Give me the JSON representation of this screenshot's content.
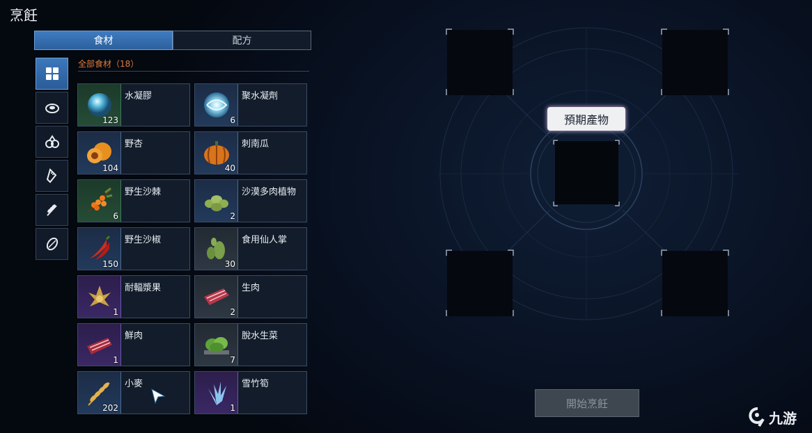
{
  "window": {
    "title": "烹飪"
  },
  "tabs": [
    {
      "label": "食材",
      "active": true
    },
    {
      "label": "配方",
      "active": false
    }
  ],
  "sidebar": {
    "items": [
      {
        "icon": "grid-icon",
        "active": true
      },
      {
        "icon": "meat-icon",
        "active": false
      },
      {
        "icon": "fruit-icon",
        "active": false
      },
      {
        "icon": "salt-shaker-icon",
        "active": false
      },
      {
        "icon": "wheat-icon",
        "active": false
      },
      {
        "icon": "seed-icon",
        "active": false
      }
    ]
  },
  "category": {
    "label": "全部食材（18）"
  },
  "ingredients": [
    {
      "name": "水凝膠",
      "count": "123",
      "rarity": "green",
      "icon": "water-orb-icon"
    },
    {
      "name": "聚水凝劑",
      "count": "6",
      "rarity": "blue",
      "icon": "water-swirl-icon"
    },
    {
      "name": "野杏",
      "count": "104",
      "rarity": "blue",
      "icon": "apricot-icon"
    },
    {
      "name": "刺南瓜",
      "count": "40",
      "rarity": "blue",
      "icon": "pumpkin-icon"
    },
    {
      "name": "野生沙棘",
      "count": "6",
      "rarity": "green",
      "icon": "sea-buckthorn-icon"
    },
    {
      "name": "沙漠多肉植物",
      "count": "2",
      "rarity": "blue",
      "icon": "succulent-icon"
    },
    {
      "name": "野生沙椒",
      "count": "150",
      "rarity": "blue",
      "icon": "chili-icon"
    },
    {
      "name": "食用仙人掌",
      "count": "30",
      "rarity": "gray",
      "icon": "cactus-icon"
    },
    {
      "name": "耐輻漿果",
      "count": "1",
      "rarity": "purple",
      "icon": "radiant-berry-icon"
    },
    {
      "name": "生肉",
      "count": "2",
      "rarity": "gray",
      "icon": "raw-meat-icon"
    },
    {
      "name": "鮮肉",
      "count": "1",
      "rarity": "purple",
      "icon": "fresh-meat-icon"
    },
    {
      "name": "脫水生菜",
      "count": "7",
      "rarity": "gray",
      "icon": "lettuce-icon"
    },
    {
      "name": "小麥",
      "count": "202",
      "rarity": "blue",
      "icon": "wheat-icon"
    },
    {
      "name": "雪竹筍",
      "count": "1",
      "rarity": "purple",
      "icon": "snow-bamboo-icon"
    }
  ],
  "cooking": {
    "expected_label": "預期產物",
    "start_button": "開始烹飪"
  },
  "watermark": {
    "text": "九游"
  },
  "colors": {
    "accent": "#3f7cc1",
    "category_label": "#e07a3a",
    "rarity_green": "#3f7a55",
    "rarity_blue": "#4a6c98",
    "rarity_purple": "#6e56b0",
    "rarity_gray": "#56616d"
  }
}
